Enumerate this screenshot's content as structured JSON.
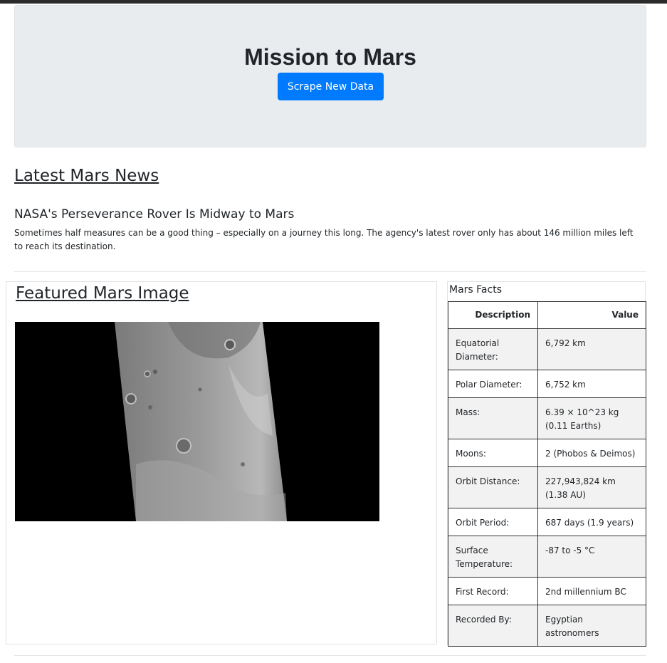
{
  "header": {
    "title": "Mission to Mars",
    "scrape_button": "Scrape New Data"
  },
  "news": {
    "heading": "Latest Mars News",
    "title": "NASA's Perseverance Rover Is Midway to Mars",
    "paragraph": "Sometimes half measures can be a good thing – especially on a journey this long. The agency's latest rover only has about 146 million miles left to reach its destination."
  },
  "featured_image": {
    "heading": "Featured Mars Image"
  },
  "facts": {
    "title": "Mars Facts",
    "headers": [
      "Description",
      "Value"
    ],
    "rows": [
      {
        "description": "Equatorial Diameter:",
        "value": "6,792 km"
      },
      {
        "description": "Polar Diameter:",
        "value": "6,752 km"
      },
      {
        "description": "Mass:",
        "value": "6.39 × 10^23 kg (0.11 Earths)"
      },
      {
        "description": "Moons:",
        "value": "2 (Phobos & Deimos)"
      },
      {
        "description": "Orbit Distance:",
        "value": "227,943,824 km (1.38 AU)"
      },
      {
        "description": "Orbit Period:",
        "value": "687 days (1.9 years)"
      },
      {
        "description": "Surface Temperature:",
        "value": "-87 to -5 °C"
      },
      {
        "description": "First Record:",
        "value": "2nd millennium BC"
      },
      {
        "description": "Recorded By:",
        "value": "Egyptian astronomers"
      }
    ]
  },
  "colors": {
    "button": "#007bff",
    "jumbotron": "#e9ecef"
  }
}
